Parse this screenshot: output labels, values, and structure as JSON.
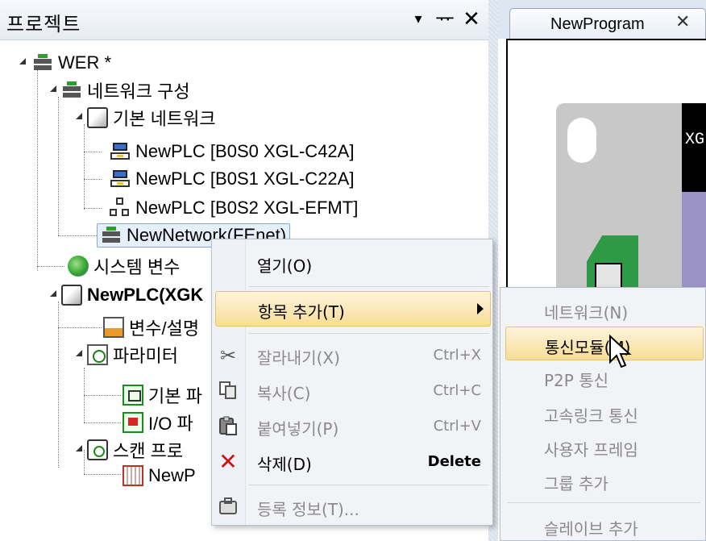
{
  "pane": {
    "title": "프로젝트",
    "dropdown_glyph": "▾",
    "pin_glyph": "ᅲ",
    "close_glyph": "✕"
  },
  "tree": {
    "root": "WER *",
    "network_config": "네트워크 구성",
    "basic_network": "기본 네트워크",
    "plc1": "NewPLC [B0S0 XGL-C42A]",
    "plc2": "NewPLC [B0S1 XGL-C22A]",
    "plc3": "NewPLC [B0S2 XGL-EFMT]",
    "new_network": "NewNetwork(FEnet)",
    "system_vars": "시스템 변수",
    "plc_main": "NewPLC(XGK",
    "var_comments": "변수/설명",
    "parameters": "파라미터",
    "basic_param": "기본 파",
    "io_param": "I/O 파",
    "scan_program": "스캔 프로",
    "new_program": "NewP"
  },
  "editor": {
    "tab_label": "NewProgram",
    "tab_close": "✕",
    "plc_text": "XG"
  },
  "context_menu": {
    "items": [
      {
        "label": "열기(O)",
        "icon": "",
        "shortcut": "",
        "enabled": true
      },
      {
        "label": "항목 추가(T)",
        "icon": "",
        "shortcut": "",
        "enabled": true
      },
      {
        "label": "잘라내기(X)",
        "icon": "scissors-icon",
        "shortcut": "Ctrl+X",
        "enabled": false
      },
      {
        "label": "복사(C)",
        "icon": "copy-icon",
        "shortcut": "Ctrl+C",
        "enabled": false
      },
      {
        "label": "붙여넣기(P)",
        "icon": "paste-icon",
        "shortcut": "Ctrl+V",
        "enabled": false
      },
      {
        "label": "삭제(D)",
        "icon": "delete-icon",
        "shortcut": "Delete",
        "enabled": true
      },
      {
        "label": "등록 정보(T)...",
        "icon": "properties-icon",
        "shortcut": "",
        "enabled": false
      }
    ]
  },
  "submenu": {
    "items": [
      {
        "label": "네트워크(N)",
        "enabled": false
      },
      {
        "label": "통신모듈(M)",
        "enabled": true
      },
      {
        "label": "P2P 통신",
        "enabled": false
      },
      {
        "label": "고속링크 통신",
        "enabled": false
      },
      {
        "label": "사용자 프레임",
        "enabled": false
      },
      {
        "label": "그룹 추가",
        "enabled": false
      },
      {
        "label": "슬레이브 추가",
        "enabled": false
      }
    ]
  },
  "colors": {
    "menu_highlight": "#f8dd96",
    "menu_highlight_border": "#e9c26a",
    "disabled_text": "#8a8a8a",
    "delete_red": "#cc1111"
  }
}
